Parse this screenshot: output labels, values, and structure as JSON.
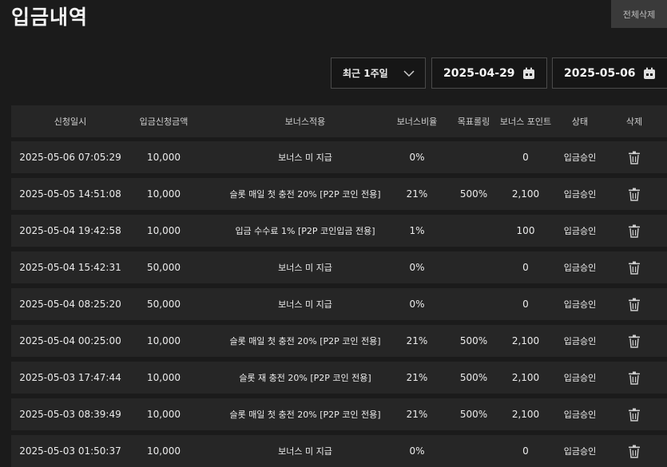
{
  "page": {
    "title": "입금내역",
    "delete_all_label": "전체삭제"
  },
  "filters": {
    "period": "최근 1주일",
    "date_from": "2025-04-29",
    "date_to": "2025-05-06"
  },
  "table": {
    "headers": [
      "신청일시",
      "입금신청금액",
      "보너스적용",
      "보너스비율",
      "목표롤링",
      "보너스 포인트",
      "상태",
      "삭제"
    ],
    "rows": [
      {
        "date": "2025-05-06 07:05:29",
        "amount": "10,000",
        "bonus": "보너스 미 지급",
        "rate": "0%",
        "target": "",
        "point": "0",
        "status": "입금승인"
      },
      {
        "date": "2025-05-05 14:51:08",
        "amount": "10,000",
        "bonus": "슬롯 매일 첫 충전 20% [P2P 코인 전용]",
        "rate": "21%",
        "target": "500%",
        "point": "2,100",
        "status": "입금승인"
      },
      {
        "date": "2025-05-04 19:42:58",
        "amount": "10,000",
        "bonus": "입금 수수료 1% [P2P 코인입금 전용]",
        "rate": "1%",
        "target": "",
        "point": "100",
        "status": "입금승인"
      },
      {
        "date": "2025-05-04 15:42:31",
        "amount": "50,000",
        "bonus": "보너스 미 지급",
        "rate": "0%",
        "target": "",
        "point": "0",
        "status": "입금승인"
      },
      {
        "date": "2025-05-04 08:25:20",
        "amount": "50,000",
        "bonus": "보너스 미 지급",
        "rate": "0%",
        "target": "",
        "point": "0",
        "status": "입금승인"
      },
      {
        "date": "2025-05-04 00:25:00",
        "amount": "10,000",
        "bonus": "슬롯 매일 첫 충전 20% [P2P 코인 전용]",
        "rate": "21%",
        "target": "500%",
        "point": "2,100",
        "status": "입금승인"
      },
      {
        "date": "2025-05-03 17:47:44",
        "amount": "10,000",
        "bonus": "슬롯 재 충전 20% [P2P 코인 전용]",
        "rate": "21%",
        "target": "500%",
        "point": "2,100",
        "status": "입금승인"
      },
      {
        "date": "2025-05-03 08:39:49",
        "amount": "10,000",
        "bonus": "슬롯 매일 첫 충전 20% [P2P 코인 전용]",
        "rate": "21%",
        "target": "500%",
        "point": "2,100",
        "status": "입금승인"
      },
      {
        "date": "2025-05-03 01:50:37",
        "amount": "10,000",
        "bonus": "보너스 미 지급",
        "rate": "0%",
        "target": "",
        "point": "0",
        "status": "입금승인"
      }
    ]
  }
}
